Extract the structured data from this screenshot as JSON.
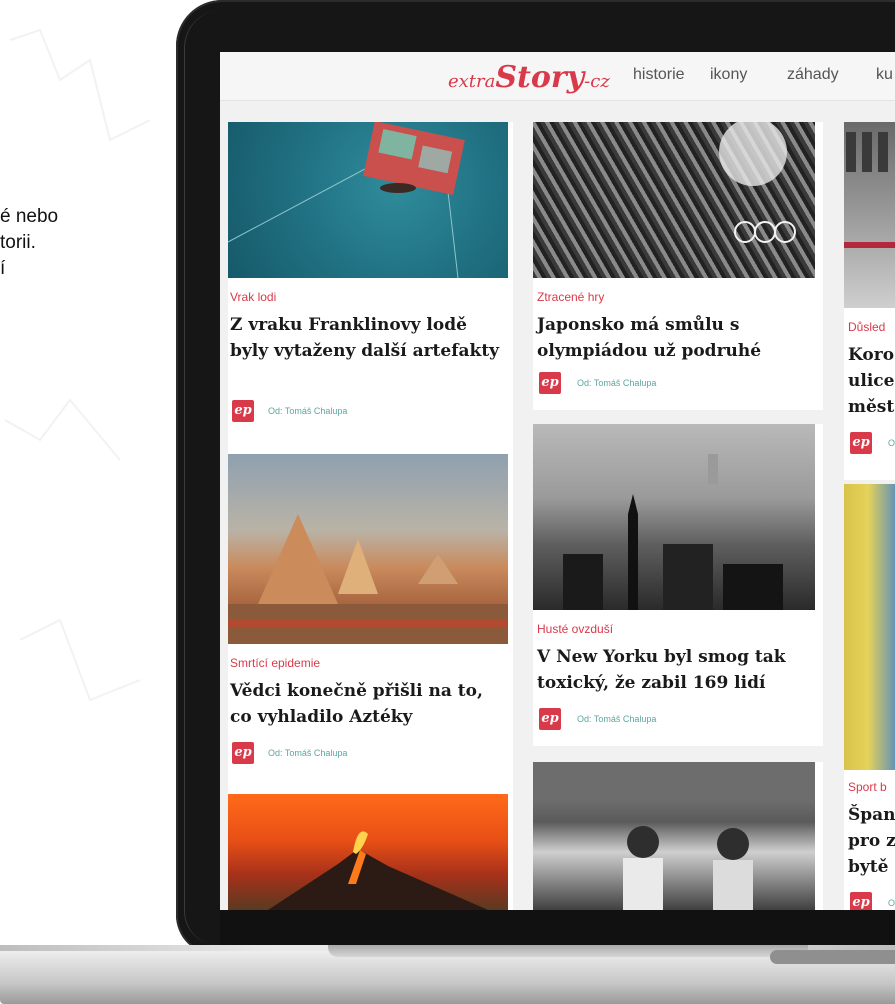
{
  "side_text": [
    "é nebo",
    "torii.",
    "í"
  ],
  "site": {
    "logo": {
      "prefix": "extra",
      "main": "Story",
      "suffix": "-cz"
    },
    "nav": [
      "historie",
      "ikony",
      "záhady",
      "ku"
    ]
  },
  "articles": [
    {
      "category": "Vrak lodi",
      "title": "Z vraku Franklinovy lodě byly vytaženy další artefakty",
      "author": "Od: Tomáš Chalupa",
      "avatar": "ep"
    },
    {
      "category": "Ztracené hry",
      "title": "Japonsko má smůlu s olympiádou už podruhé",
      "author": "Od: Tomáš Chalupa",
      "avatar": "ep"
    },
    {
      "category": "Důsled",
      "title": "Koro ulice měst",
      "author": "O",
      "avatar": "ep"
    },
    {
      "category": "Smrtící epidemie",
      "title": "Vědci konečně přišli na to, co vyhladilo Aztéky",
      "author": "Od: Tomáš Chalupa",
      "avatar": "ep"
    },
    {
      "category": "Husté ovzduší",
      "title": "V New Yorku byl smog tak toxický, že zabil 169 lidí",
      "author": "Od: Tomáš Chalupa",
      "avatar": "ep"
    },
    {
      "category": "Sport b",
      "title": "Špan pro z bytě",
      "author": "O",
      "avatar": "ep"
    }
  ]
}
